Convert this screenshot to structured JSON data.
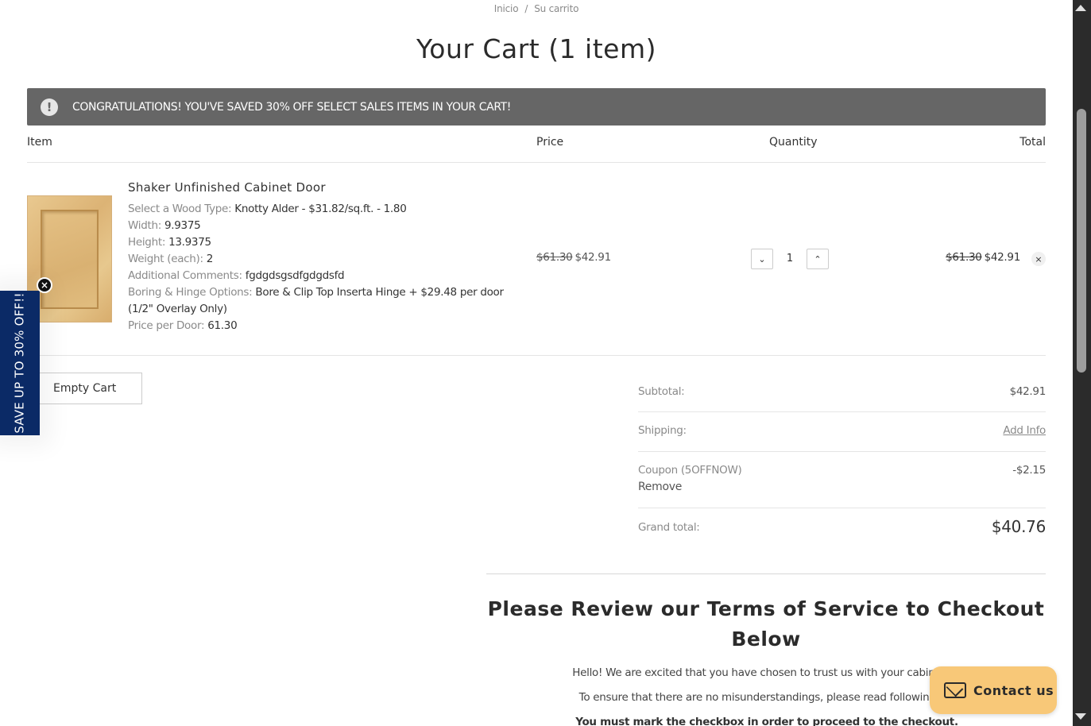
{
  "breadcrumb": {
    "home": "Inicio",
    "separator": "/",
    "current": "Su carrito"
  },
  "page_title": "Your Cart (1 item)",
  "promo_banner": {
    "icon": "alert-icon",
    "text": "CONGRATULATIONS! YOU'VE SAVED 30% OFF SELECT SALES ITEMS IN YOUR CART!"
  },
  "table_headers": {
    "item": "Item",
    "price": "Price",
    "quantity": "Quantity",
    "total": "Total"
  },
  "cart_item": {
    "name": "Shaker Unfinished Cabinet Door",
    "options": [
      {
        "label": "Select a Wood Type:",
        "value": "Knotty Alder - $31.82/sq.ft. - 1.80"
      },
      {
        "label": "Width:",
        "value": "9.9375"
      },
      {
        "label": "Height:",
        "value": "13.9375"
      },
      {
        "label": "Weight (each):",
        "value": "2"
      },
      {
        "label": "Additional Comments:",
        "value": "fgdgdsgsdfgdgdsfd"
      },
      {
        "label": "Boring & Hinge Options:",
        "value": "Bore & Clip Top Inserta Hinge + $29.48 per door (1/2\" Overlay Only)"
      },
      {
        "label": "Price per Door:",
        "value": "61.30"
      }
    ],
    "price_original": "$61.30",
    "price_sale": "$42.91",
    "quantity": "1",
    "total_original": "$61.30",
    "total_sale": "$42.91",
    "remove_symbol": "×"
  },
  "empty_cart_label": "Empty Cart",
  "totals": {
    "subtotal_label": "Subtotal:",
    "subtotal_value": "$42.91",
    "shipping_label": "Shipping:",
    "shipping_value": "Add Info",
    "coupon_label": "Coupon (5OFFNOW)",
    "coupon_value": "-$2.15",
    "coupon_remove": "Remove",
    "grand_label": "Grand total:",
    "grand_value": "$40.76"
  },
  "tos": {
    "title": "Please Review our Terms of Service to Checkout Below",
    "p1": "Hello! We are excited that you have chosen to trust us with your cabinet do",
    "p2": "To ensure that there are no misunderstandings, please read following sta",
    "p3": "You must mark the checkbox in order to proceed to the checkout."
  },
  "side_promo": {
    "text": "SAVE UP TO 30% OFF!!",
    "close_symbol": "×"
  },
  "contact": {
    "label": "Contact us",
    "icon": "mail-icon"
  },
  "colors": {
    "banner_bg": "#666666",
    "side_tab_bg": "#0b2a66",
    "contact_bg": "#f8c878"
  }
}
